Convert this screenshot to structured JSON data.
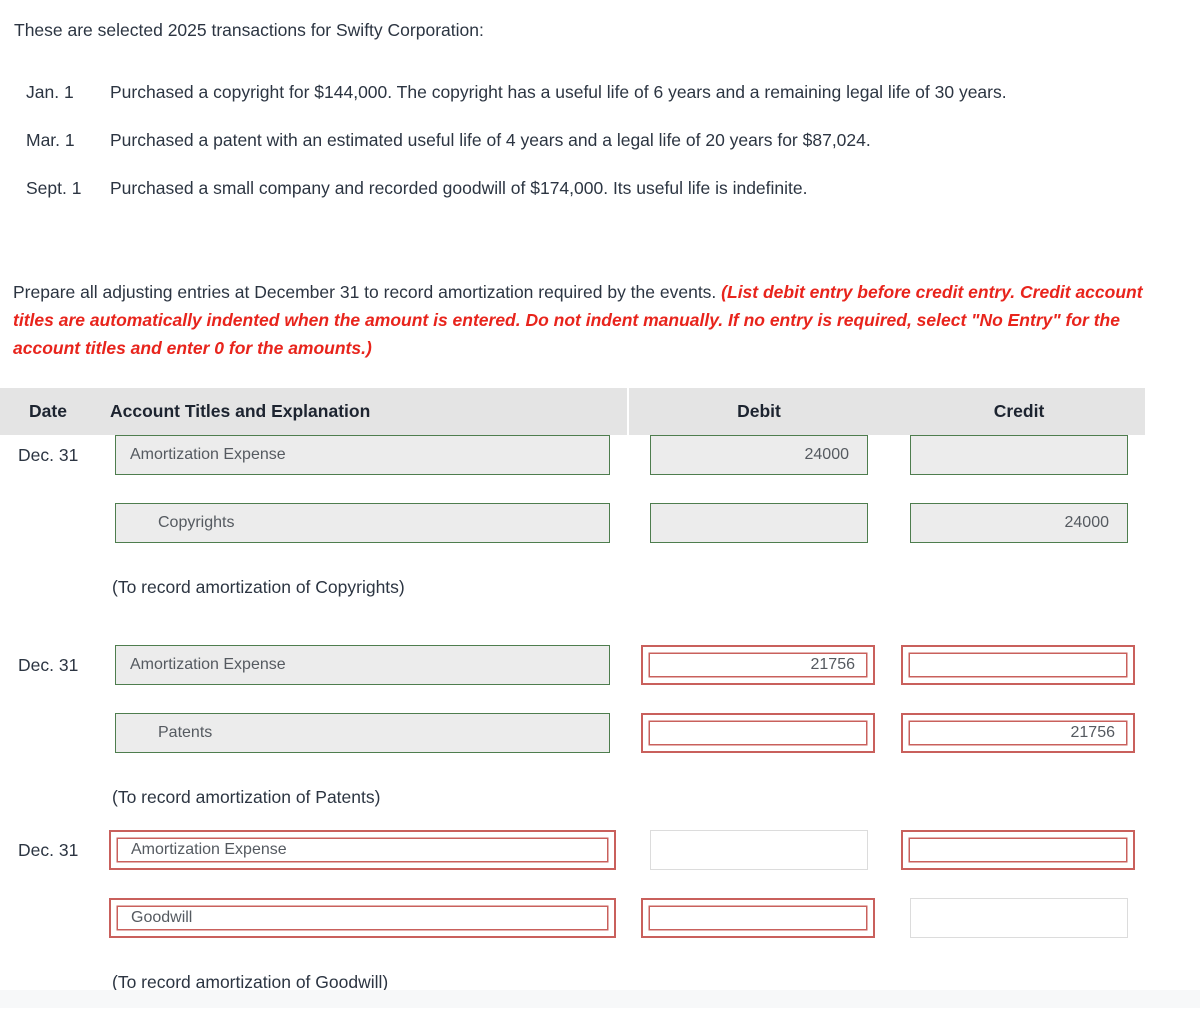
{
  "intro": "These are selected 2025 transactions for Swifty Corporation:",
  "transactions": [
    {
      "date": "Jan. 1",
      "description": "Purchased a copyright for $144,000. The copyright has a useful life of 6 years and a remaining legal life of 30 years."
    },
    {
      "date": "Mar. 1",
      "description": "Purchased a patent with an estimated useful life of 4 years and a legal life of 20 years for $87,024."
    },
    {
      "date": "Sept. 1",
      "description": "Purchased a small company and recorded goodwill of $174,000. Its useful life is indefinite."
    }
  ],
  "requirement": {
    "black": "Prepare all adjusting entries at December 31 to record amortization required by the events.",
    "red": "(List debit entry before credit entry. Credit account titles are automatically indented when the amount is entered. Do not indent manually. If no entry is required, select \"No Entry\" for the account titles and enter 0 for the amounts.)"
  },
  "table": {
    "headers": {
      "date": "Date",
      "account": "Account Titles and Explanation",
      "debit": "Debit",
      "credit": "Credit"
    },
    "entries": [
      {
        "date": "Dec. 31",
        "debit_line": {
          "account": "Amortization Expense",
          "account_state": "green",
          "debit": "24000",
          "debit_state": "green",
          "credit": "",
          "credit_state": "green",
          "indent": false
        },
        "credit_line": {
          "account": "Copyrights",
          "account_state": "green",
          "debit": "",
          "debit_state": "green",
          "credit": "24000",
          "credit_state": "green",
          "indent": true
        },
        "explanation": "(To record amortization of Copyrights)"
      },
      {
        "date": "Dec. 31",
        "debit_line": {
          "account": "Amortization Expense",
          "account_state": "green",
          "debit": "21756",
          "debit_state": "red",
          "credit": "",
          "credit_state": "red",
          "indent": false
        },
        "credit_line": {
          "account": "Patents",
          "account_state": "green",
          "debit": "",
          "debit_state": "red",
          "credit": "21756",
          "credit_state": "red",
          "indent": true
        },
        "explanation": "(To record amortization of Patents)"
      },
      {
        "date": "Dec. 31",
        "debit_line": {
          "account": "Amortization Expense",
          "account_state": "red",
          "debit": "",
          "debit_state": "plain",
          "credit": "",
          "credit_state": "red",
          "indent": false
        },
        "credit_line": {
          "account": "Goodwill",
          "account_state": "red",
          "debit": "",
          "debit_state": "red",
          "credit": "",
          "credit_state": "plain",
          "indent": false
        },
        "explanation": "(To record amortization of Goodwill)"
      }
    ]
  },
  "colors": {
    "text": "#2c3542",
    "red_instruction": "#e8241c",
    "valid_border": "#4e7d4e",
    "invalid_border": "#c9605c",
    "header_bg": "#e4e4e4",
    "field_bg": "#ececec"
  }
}
